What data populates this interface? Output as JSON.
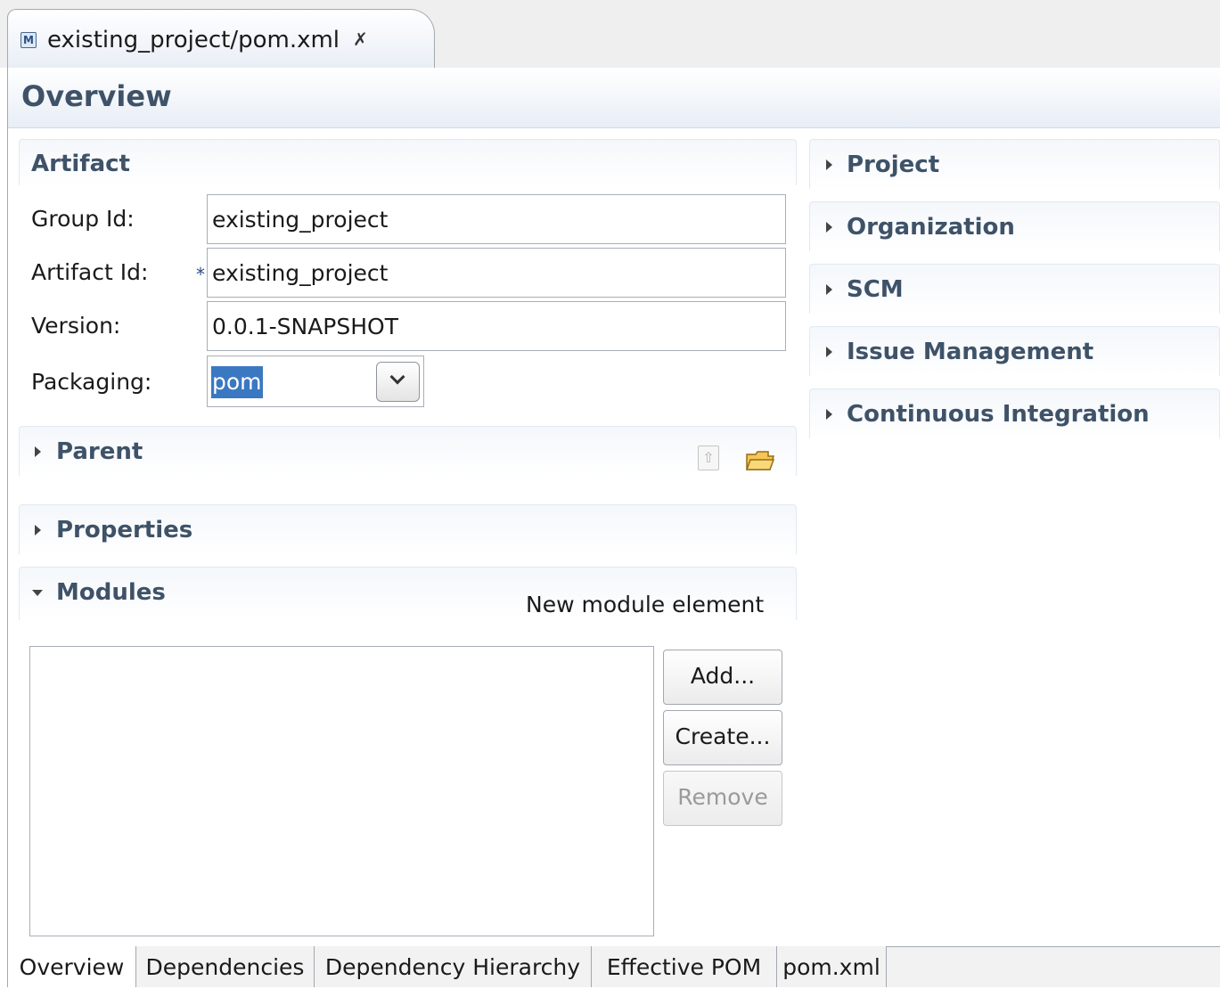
{
  "editor_tab": {
    "title": "existing_project/pom.xml",
    "icon": "maven-pom-file-icon",
    "close_icon": "close-icon"
  },
  "page_title": "Overview",
  "artifact": {
    "title": "Artifact",
    "group_id_label": "Group Id:",
    "group_id_value": "existing_project",
    "artifact_id_label": "Artifact Id:",
    "artifact_id_required": "*",
    "artifact_id_value": "existing_project",
    "version_label": "Version:",
    "version_value": "0.0.1-SNAPSHOT",
    "packaging_label": "Packaging:",
    "packaging_value": "pom"
  },
  "parent": {
    "title": "Parent",
    "expanded": false
  },
  "properties": {
    "title": "Properties",
    "expanded": false
  },
  "modules": {
    "title": "Modules",
    "expanded": true,
    "hint": "New module element",
    "items": [],
    "add_label": "Add...",
    "create_label": "Create...",
    "remove_label": "Remove",
    "remove_enabled": false
  },
  "right_sections": [
    {
      "title": "Project",
      "expanded": false
    },
    {
      "title": "Organization",
      "expanded": false
    },
    {
      "title": "SCM",
      "expanded": false
    },
    {
      "title": "Issue Management",
      "expanded": false
    },
    {
      "title": "Continuous Integration",
      "expanded": false
    }
  ],
  "page_tabs": [
    "Overview",
    "Dependencies",
    "Dependency Hierarchy",
    "Effective POM",
    "pom.xml"
  ],
  "active_page_tab": "Overview",
  "colors": {
    "section_title": "#3e5268",
    "selection": "#3b78c2",
    "border": "#a3a8b0"
  }
}
